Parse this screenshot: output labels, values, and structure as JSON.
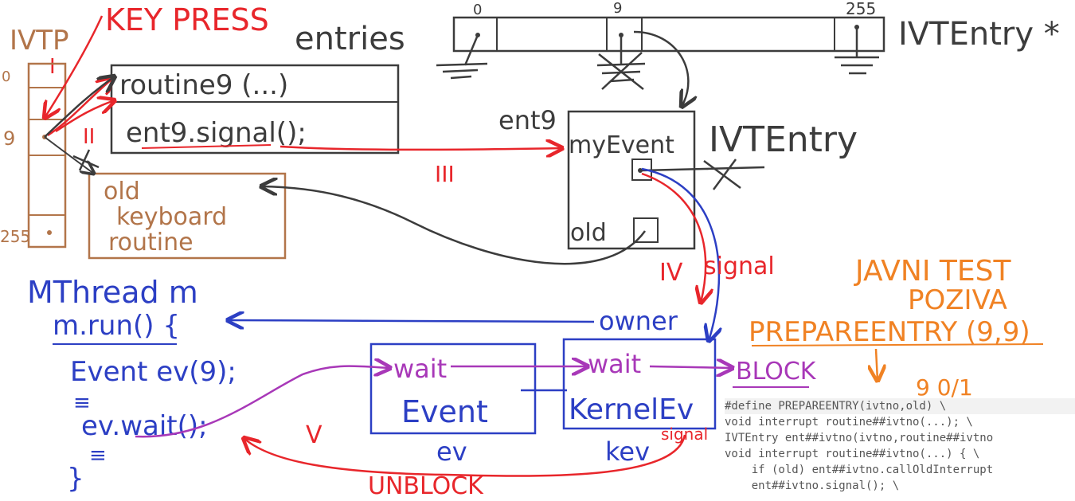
{
  "colors": {
    "red": "#e8262b",
    "blue": "#2c3fc4",
    "dark": "#3c3c3c",
    "brown": "#b2754a",
    "purple": "#a838b8",
    "orange": "#f08224",
    "code_text": "#555555"
  },
  "ivtp": {
    "label": "IVTP",
    "roman_one": "I",
    "idx_0": "0",
    "idx_9": "9",
    "idx_255": "255"
  },
  "key_press": "KEY PRESS",
  "entries": {
    "label": "entries",
    "idx_0": "0",
    "idx_9": "9",
    "idx_255": "255",
    "type": "IVTEntry *"
  },
  "routines": {
    "routine9": "routine9 (...)",
    "ent9_signal": "ent9.signal();",
    "roman_two": "II"
  },
  "old_keyboard": {
    "line1": "old",
    "line2": "keyboard",
    "line3": "routine"
  },
  "ivtentry": {
    "ent9_label": "ent9",
    "my_event": "myEvent",
    "old": "old",
    "type": "IVTEntry"
  },
  "arrow_labels": {
    "three": "III",
    "four": "IV",
    "signal": "signal",
    "five": "V",
    "unblock": "UNBLOCK"
  },
  "mthread": {
    "decl": "MThread m",
    "run": "m.run() {",
    "event_decl": "Event ev(9);",
    "dots1": "≡",
    "wait_call": "ev.wait();",
    "dots2": "≡",
    "close": "}"
  },
  "event_box": {
    "wait": "wait",
    "name": "Event",
    "var": "ev"
  },
  "kernel_box": {
    "wait": "wait",
    "name": "KernelEv",
    "var": "kev",
    "signal": "signal"
  },
  "owner_label": "owner",
  "block_label": "BLOCK",
  "orange_note": {
    "line1": "JAVNI TEST",
    "line2": "POZIVA",
    "line3": "PREPAREENTRY (9,9)",
    "args": "9   0/1"
  },
  "code_lines": [
    "#define PREPAREENTRY(ivtno,old) \\",
    "void interrupt routine##ivtno(...); \\",
    "IVTEntry ent##ivtno(ivtno,routine##ivtno",
    "void interrupt routine##ivtno(...) { \\",
    "    if (old) ent##ivtno.callOldInterrupt",
    "    ent##ivtno.signal(); \\"
  ]
}
